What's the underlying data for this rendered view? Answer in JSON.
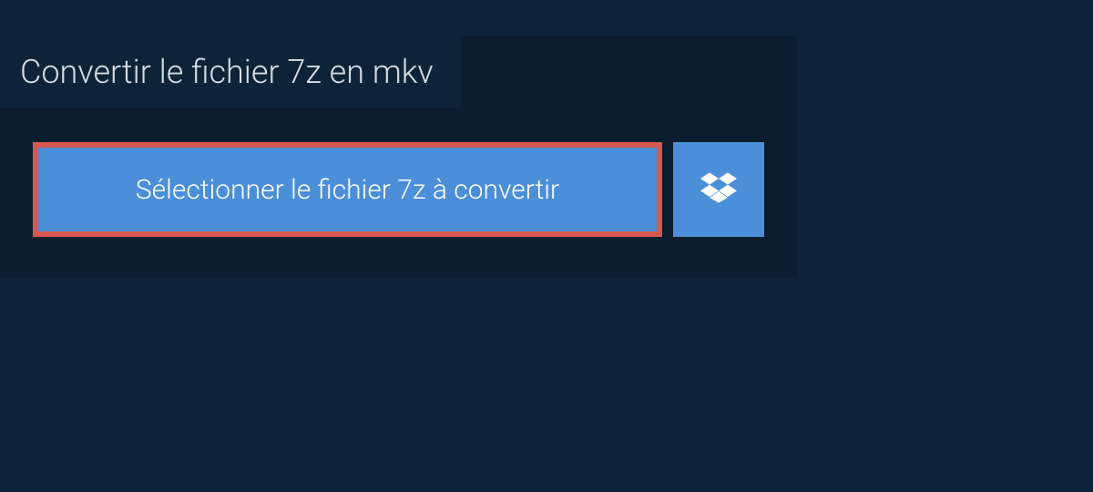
{
  "tab": {
    "title": "Convertir le fichier 7z en mkv"
  },
  "actions": {
    "select_file_label": "Sélectionner le fichier 7z à convertir"
  },
  "colors": {
    "accent": "#4a8fd8",
    "highlight_border": "#d9584f",
    "bg_dark": "#0d2438",
    "bg_panel": "#0a1d2e"
  }
}
